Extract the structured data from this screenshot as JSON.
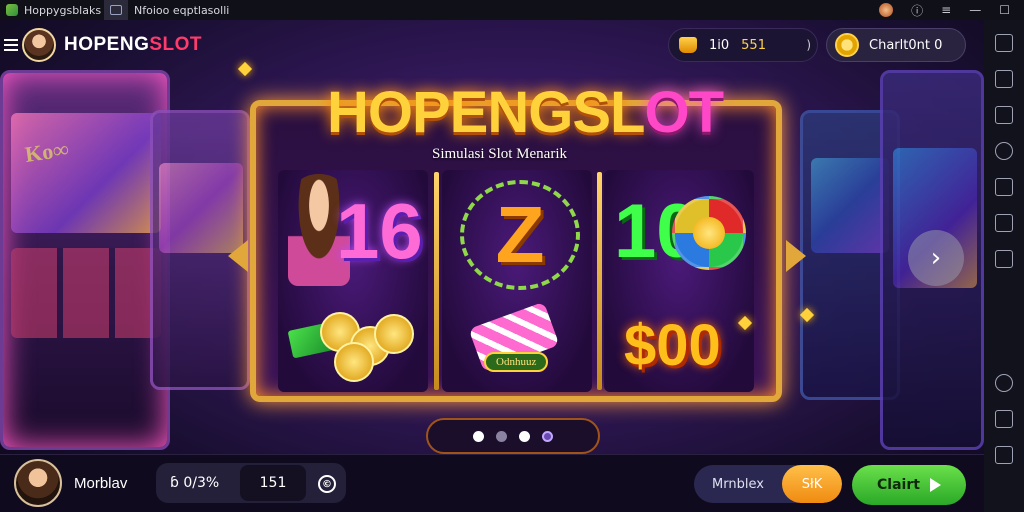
{
  "titlebar": {
    "app_name": "Hoppygsblaks",
    "tab_label": "Nfoioo eqptlasolli",
    "tab_first_label": "☐"
  },
  "header": {
    "brand_main": "HOPENG",
    "brand_accent": "SLOT",
    "balance_a": "1i0",
    "balance_b": "551",
    "balance_arrow": ")",
    "coin_label": "Charlt0nt 0"
  },
  "banner": {
    "title_main": "HOPENGSL",
    "title_accent": "O",
    "title_end": "T",
    "subtitle": "Simulasi Slot Menarik"
  },
  "reels": {
    "symbol_number_1": "16",
    "symbol_letter": "Z",
    "symbol_number_2": "10",
    "ticket_label": "Odnhuuz",
    "symbol_money": "$00"
  },
  "carousel": {
    "next_glyph": "›",
    "dots": 4,
    "active_dot": 4
  },
  "bottom": {
    "player_name": "Morblav",
    "stat_a": "ɓ 0/3%",
    "stat_b": "151",
    "info_glyph": "©",
    "mode_label": "Mrnblex",
    "auto_label": "SłK",
    "spin_label": "Clairt"
  },
  "colors": {
    "accent_gold": "#e2a73a",
    "accent_pink": "#ff3b6b",
    "spin_green": "#2aa828",
    "auto_orange": "#f08a10"
  }
}
